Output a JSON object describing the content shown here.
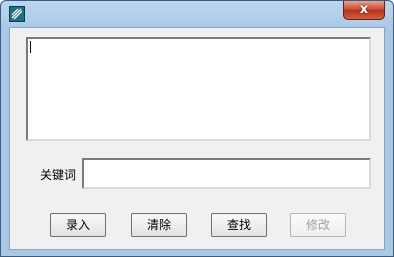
{
  "titlebar": {
    "icon": "app-icon",
    "close_label": "x"
  },
  "memo": {
    "value": ""
  },
  "keyword": {
    "label": "关键词",
    "value": ""
  },
  "buttons": [
    {
      "label": "录入",
      "enabled": true
    },
    {
      "label": "清除",
      "enabled": true
    },
    {
      "label": "查找",
      "enabled": true
    },
    {
      "label": "修改",
      "enabled": false
    }
  ]
}
